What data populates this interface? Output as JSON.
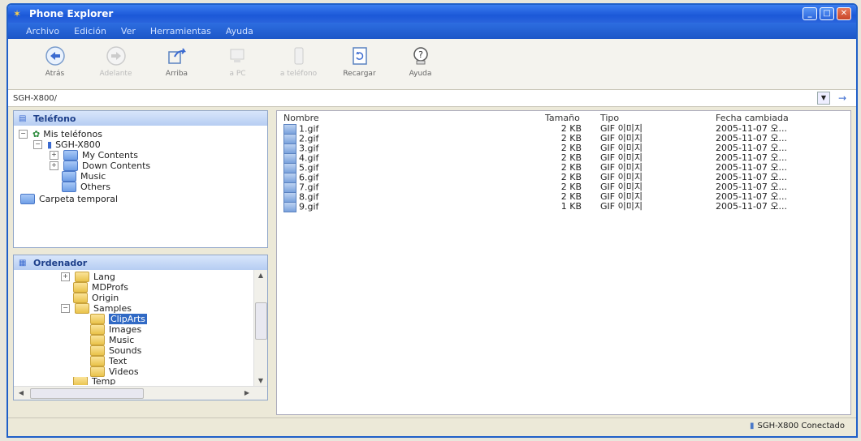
{
  "window": {
    "title": "Phone Explorer"
  },
  "menu": [
    "Archivo",
    "Edición",
    "Ver",
    "Herramientas",
    "Ayuda"
  ],
  "toolbar": [
    {
      "label": "Atrás",
      "icon": "back-arrow-icon",
      "enabled": true
    },
    {
      "label": "Adelante",
      "icon": "forward-arrow-icon",
      "enabled": false
    },
    {
      "label": "Arriba",
      "icon": "up-folder-icon",
      "enabled": true
    },
    {
      "label": "a PC",
      "icon": "to-pc-icon",
      "enabled": false
    },
    {
      "label": "a teléfono",
      "icon": "to-phone-icon",
      "enabled": false
    },
    {
      "label": "Recargar",
      "icon": "reload-icon",
      "enabled": true
    },
    {
      "label": "Ayuda",
      "icon": "help-icon",
      "enabled": true
    }
  ],
  "address": {
    "path": "SGH-X800/"
  },
  "phone_panel": {
    "title": "Teléfono",
    "items": [
      "Mis teléfonos",
      "SGH-X800",
      "My Contents",
      "Down Contents",
      "Music",
      "Others",
      "Carpeta temporal"
    ]
  },
  "computer_panel": {
    "title": "Ordenador",
    "items": [
      "Lang",
      "MDProfs",
      "Origin",
      "Samples",
      "ClipArts",
      "Images",
      "Music",
      "Sounds",
      "Text",
      "Videos",
      "Temp"
    ]
  },
  "file_list": {
    "columns": [
      "Nombre",
      "Tamaño",
      "Tipo",
      "Fecha cambiada"
    ],
    "rows": [
      [
        "1.gif",
        "2 KB",
        "GIF 이미지",
        "2005-11-07 오..."
      ],
      [
        "2.gif",
        "2 KB",
        "GIF 이미지",
        "2005-11-07 오..."
      ],
      [
        "3.gif",
        "2 KB",
        "GIF 이미지",
        "2005-11-07 오..."
      ],
      [
        "4.gif",
        "2 KB",
        "GIF 이미지",
        "2005-11-07 오..."
      ],
      [
        "5.gif",
        "2 KB",
        "GIF 이미지",
        "2005-11-07 오..."
      ],
      [
        "6.gif",
        "2 KB",
        "GIF 이미지",
        "2005-11-07 오..."
      ],
      [
        "7.gif",
        "2 KB",
        "GIF 이미지",
        "2005-11-07 오..."
      ],
      [
        "8.gif",
        "2 KB",
        "GIF 이미지",
        "2005-11-07 오..."
      ],
      [
        "9.gif",
        "1 KB",
        "GIF 이미지",
        "2005-11-07 오..."
      ]
    ]
  },
  "status": {
    "text": "SGH-X800 Conectado"
  }
}
